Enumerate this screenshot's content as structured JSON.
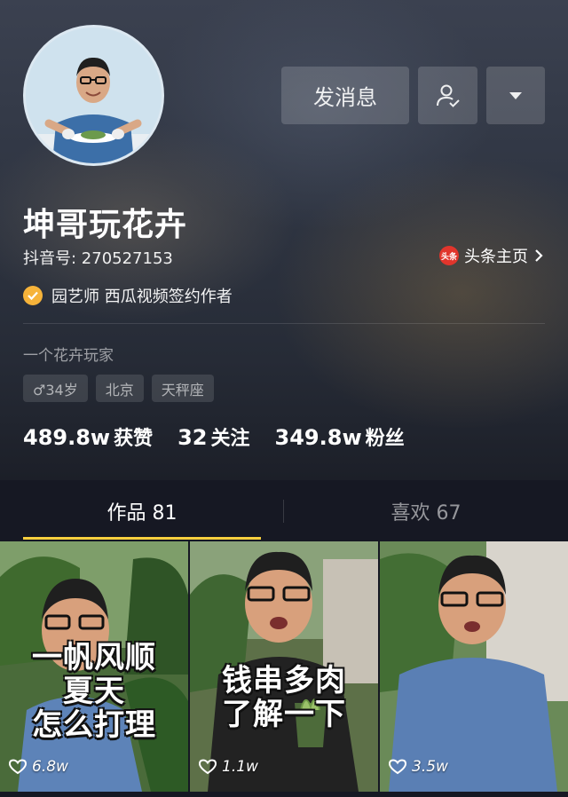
{
  "profile": {
    "nickname": "坤哥玩花卉",
    "douyin_id": "抖音号: 270527153",
    "toutiao_logo_text": "头条",
    "toutiao_link": "头条主页",
    "verification": "园艺师 西瓜视频签约作者",
    "bio": "一个花卉玩家",
    "tags": [
      "♂34岁",
      "北京",
      "天秤座"
    ],
    "stats": [
      {
        "value": "489.8w",
        "label": "获赞"
      },
      {
        "value": "32",
        "label": "关注"
      },
      {
        "value": "349.8w",
        "label": "粉丝"
      }
    ]
  },
  "actions": {
    "message_label": "发消息",
    "follow_icon": "user-check-icon",
    "more_icon": "caret-down-icon"
  },
  "tabs": [
    {
      "label": "作品 81",
      "active": true
    },
    {
      "label": "喜欢 67",
      "active": false
    }
  ],
  "videos": [
    {
      "caption_lines": [
        "一帆风顺",
        "夏天",
        "怎么打理"
      ],
      "likes": "6.8w"
    },
    {
      "caption_lines": [
        "钱串多肉",
        "了解一下"
      ],
      "likes": "1.1w"
    },
    {
      "caption_lines": [],
      "likes": "3.5w"
    }
  ],
  "colors": {
    "tab_indicator": "#facf3e",
    "verify_badge": "#f6b33a",
    "toutiao_logo": "#e1352c",
    "background": "#161823"
  }
}
